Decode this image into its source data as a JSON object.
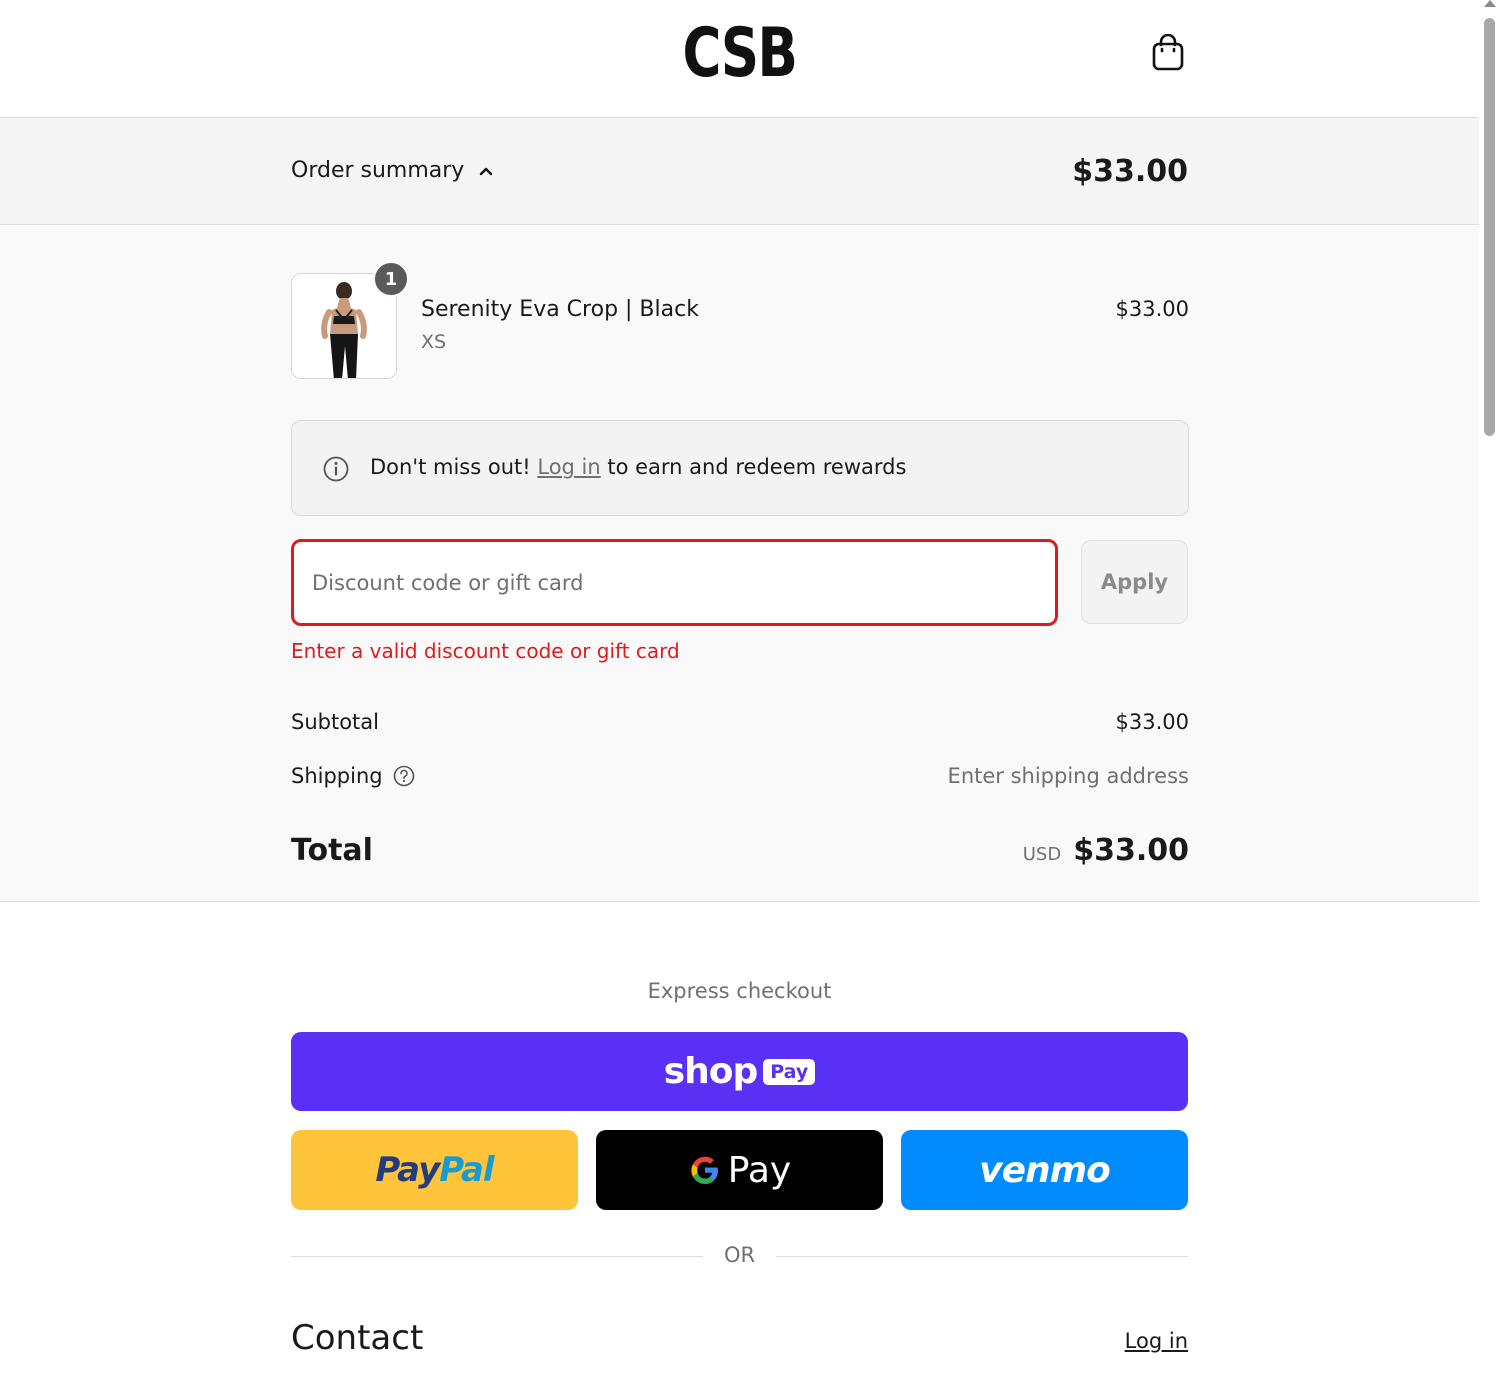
{
  "header": {
    "logo": "CSB",
    "cart_icon": "shopping-bag-icon"
  },
  "summary_bar": {
    "toggle_label": "Order summary",
    "toggle_icon": "chevron-up-icon",
    "total": "$33.00"
  },
  "line_item": {
    "quantity": "1",
    "name": "Serenity Eva Crop | Black",
    "variant": "XS",
    "price": "$33.00"
  },
  "rewards": {
    "icon": "info-icon",
    "prefix": "Don't miss out!",
    "link": "Log in",
    "suffix": "to earn and redeem rewards"
  },
  "discount": {
    "placeholder": "Discount code or gift card",
    "value": "",
    "apply_label": "Apply",
    "error": "Enter a valid discount code or gift card"
  },
  "totals": {
    "subtotal_label": "Subtotal",
    "subtotal_value": "$33.00",
    "shipping_label": "Shipping",
    "shipping_help_icon": "question-circle-icon",
    "shipping_value": "Enter shipping address",
    "total_label": "Total",
    "currency": "USD",
    "total_value": "$33.00"
  },
  "express": {
    "label": "Express checkout",
    "shop_pay_word": "shop",
    "shop_pay_pill": "Pay",
    "paypal_part1": "Pay",
    "paypal_part2": "Pal",
    "gpay_label": "Pay",
    "venmo_label": "venmo",
    "or_label": "OR"
  },
  "contact": {
    "title": "Contact",
    "login_link": "Log in"
  },
  "colors": {
    "error": "#dd1d1d",
    "shop_pay": "#5a31f4",
    "paypal": "#ffc439",
    "gpay": "#000000",
    "venmo": "#008cff"
  }
}
